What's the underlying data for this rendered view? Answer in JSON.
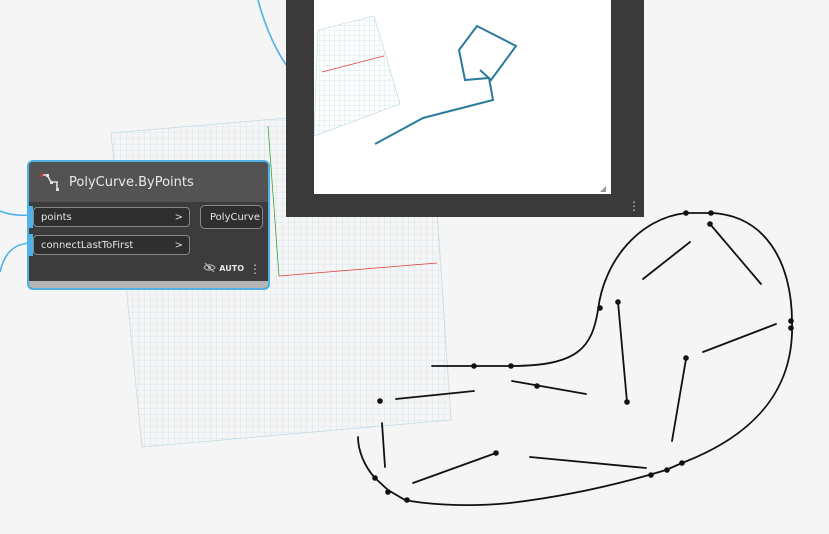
{
  "node": {
    "title": "PolyCurve.ByPoints",
    "inputs": [
      {
        "label": "points",
        "chevron": ">"
      },
      {
        "label": "connectLastToFirst",
        "chevron": ">"
      }
    ],
    "output": {
      "label": "PolyCurve"
    },
    "run_mode": "AUTO"
  },
  "colors": {
    "canvas": "#f5f5f5",
    "node_body": "#3c3c3c",
    "node_header": "#535353",
    "accent": "#4fb1e6",
    "preview_frame": "#3a3a3a",
    "preview_curve": "#2a7c9c",
    "grid": "#c3dbe6",
    "axis_x": "#e23a3a",
    "axis_y": "#3aa33a"
  },
  "icons": [
    "polycurve-node-icon",
    "eye-hidden-icon",
    "more-vertical-icon",
    "resize-grip-icon"
  ]
}
